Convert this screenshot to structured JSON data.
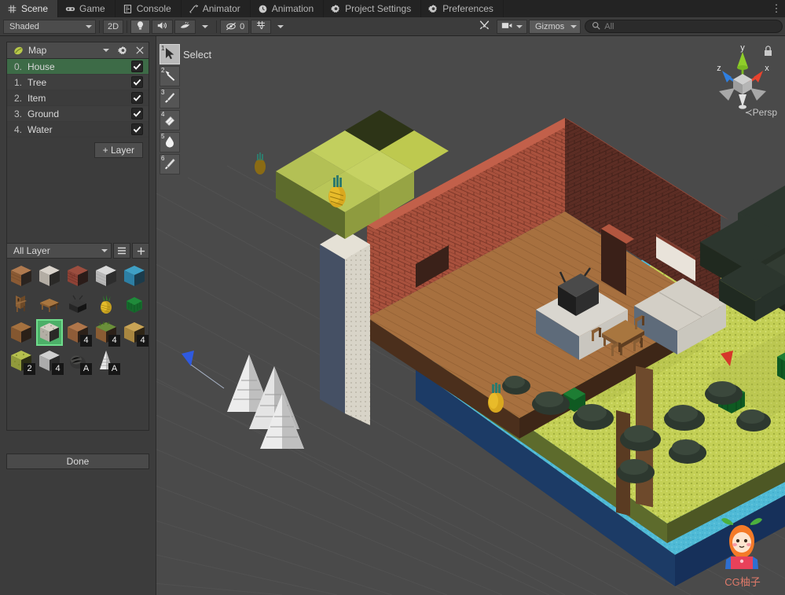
{
  "window": {
    "tabs": [
      {
        "label": "Scene",
        "icon": "grid-icon",
        "active": true
      },
      {
        "label": "Game",
        "icon": "gamepad-icon",
        "active": false
      },
      {
        "label": "Console",
        "icon": "console-icon",
        "active": false
      },
      {
        "label": "Animator",
        "icon": "animator-icon",
        "active": false
      },
      {
        "label": "Animation",
        "icon": "clock-icon",
        "active": false
      },
      {
        "label": "Project Settings",
        "icon": "gear-icon",
        "active": false
      },
      {
        "label": "Preferences",
        "icon": "gear-icon",
        "active": false
      }
    ],
    "menu_glyph": "⋮"
  },
  "toolbar": {
    "shading_mode": "Shaded",
    "two_d_label": "2D",
    "lighting_icon": "lightbulb-icon",
    "audio_icon": "speaker-icon",
    "fx_icon": "effects-icon",
    "hidden_count": "0",
    "hidden_icon": "eye-off-icon",
    "grid_icon": "grid-visibility-icon",
    "tools_icon": "tools-icon",
    "camera_icon": "camera-icon",
    "gizmos_label": "Gizmos",
    "search_placeholder": "All",
    "search_value": "",
    "search_icon": "search-icon"
  },
  "map_panel": {
    "title": "Map",
    "asset_icon": "map-asset-icon",
    "settings_icon": "gear-icon",
    "close_icon": "close-icon",
    "layers": [
      {
        "index": "0.",
        "name": "House",
        "visible": true,
        "selected": true
      },
      {
        "index": "1.",
        "name": "Tree",
        "visible": true,
        "selected": false
      },
      {
        "index": "2.",
        "name": "Item",
        "visible": true,
        "selected": false
      },
      {
        "index": "3.",
        "name": "Ground",
        "visible": true,
        "selected": false
      },
      {
        "index": "4.",
        "name": "Water",
        "visible": true,
        "selected": false
      }
    ],
    "add_layer_label": "+ Layer"
  },
  "palette": {
    "filter_label": "All Layer",
    "list_icon": "list-icon",
    "add_icon": "plus-icon",
    "tiles": [
      {
        "name": "wood-plank-block",
        "kind": "cube",
        "top": "#b07a4f",
        "left": "#8a5a34",
        "right": "#2b2420",
        "badge": ""
      },
      {
        "name": "white-stone-block",
        "kind": "cube",
        "top": "#d9d3cb",
        "left": "#b3ada4",
        "right": "#2a2927",
        "badge": ""
      },
      {
        "name": "brick-block",
        "kind": "brick",
        "top": "#9c4e3f",
        "left": "#8e4236",
        "right": "#2b1c19",
        "badge": ""
      },
      {
        "name": "concrete-block",
        "kind": "cube",
        "top": "#d8d8d8",
        "left": "#b8b8b8",
        "right": "#2d2d2d",
        "badge": ""
      },
      {
        "name": "water-block",
        "kind": "cube",
        "top": "#3f9fc4",
        "left": "#2d7fa4",
        "right": "#1b3b4b",
        "badge": ""
      },
      {
        "name": "chair-prop",
        "kind": "chair",
        "top": "#9a6c3f",
        "left": "#7d5530",
        "right": "#2a2018",
        "badge": ""
      },
      {
        "name": "table-prop",
        "kind": "table",
        "top": "#a9763f",
        "left": "#8a5d2f",
        "right": "#2a2018",
        "badge": ""
      },
      {
        "name": "tv-prop",
        "kind": "tv",
        "top": "#3a3a3a",
        "left": "#262626",
        "right": "#141414",
        "badge": ""
      },
      {
        "name": "pineapple-prop",
        "kind": "fruit",
        "top": "#e3bb2a",
        "left": "#c49f1f",
        "right": "#3a2f10",
        "badge": ""
      },
      {
        "name": "cabbage-prop",
        "kind": "cabbage",
        "top": "#1f8a3a",
        "left": "#16692c",
        "right": "#0c3317",
        "badge": ""
      },
      {
        "name": "dirt-block",
        "kind": "cube",
        "top": "#a5713f",
        "left": "#845730",
        "right": "#2b2018",
        "badge": ""
      },
      {
        "name": "gravel-block",
        "kind": "cube",
        "top": "#d6d0c6",
        "left": "#b3aea4",
        "right": "#2a2927",
        "badge": ""
      },
      {
        "name": "clay-block",
        "kind": "cube",
        "top": "#b0764a",
        "left": "#8e5c38",
        "right": "#2b2018",
        "badge": "4"
      },
      {
        "name": "grass-dirt-block",
        "kind": "grassy",
        "top": "#6b8f3a",
        "left": "#8a5c33",
        "right": "#2b2018",
        "badge": "4"
      },
      {
        "name": "sand-block",
        "kind": "cube",
        "top": "#c9a455",
        "left": "#a88640",
        "right": "#2e2516",
        "badge": "4"
      },
      {
        "name": "moss-block",
        "kind": "cube",
        "top": "#b6c04f",
        "left": "#919a3c",
        "right": "#2c2e15",
        "badge": "2"
      },
      {
        "name": "stone-block",
        "kind": "cube",
        "top": "#cfcfcf",
        "left": "#ababab",
        "right": "#2a2a2a",
        "badge": "4"
      },
      {
        "name": "bush-prop",
        "kind": "bush",
        "top": "#4a4a48",
        "left": "#343434",
        "right": "#1b1b1b",
        "badge": "A"
      },
      {
        "name": "pine-tree-prop",
        "kind": "pine",
        "top": "#e8e8e8",
        "left": "#c4c4c4",
        "right": "#8f8f8f",
        "badge": "A"
      }
    ],
    "selected_index": 11
  },
  "done_button": {
    "label": "Done"
  },
  "scene_view": {
    "tools": [
      {
        "num": "1",
        "name": "select-tool",
        "icon": "cursor-icon",
        "active": true
      },
      {
        "num": "2",
        "name": "marker-tool",
        "icon": "marker-icon",
        "active": false
      },
      {
        "num": "3",
        "name": "brush-tool",
        "icon": "brush-icon",
        "active": false
      },
      {
        "num": "4",
        "name": "eraser-tool",
        "icon": "eraser-icon",
        "active": false
      },
      {
        "num": "5",
        "name": "fill-tool",
        "icon": "droplet-icon",
        "active": false
      },
      {
        "num": "6",
        "name": "picker-tool",
        "icon": "eyedropper-icon",
        "active": false
      }
    ],
    "active_tool_label": "Select",
    "gizmo": {
      "axis_x_label": "x",
      "axis_y_label": "y",
      "axis_z_label": "z",
      "axis_x_color": "#e8432e",
      "axis_y_color": "#8fce2a",
      "axis_z_color": "#2f7fe0",
      "projection_label": "Persp",
      "projection_prefix": "≺",
      "lock_icon": "lock-icon"
    },
    "background_color": "#4a4a4a",
    "scene_content": {
      "description": "Voxel island diorama",
      "water_color": "#4fbad6",
      "water_side_color": "#1c3b66",
      "grass_color": "#c2cf4e",
      "grass_dark_color": "#5d6b2c",
      "brick_color": "#a84f3c",
      "floor_color": "#a7703f",
      "tree_dark_color": "#27312a",
      "tree_trunk_color": "#7a5134",
      "pillar_color": "#d8d4c8",
      "pineapple_color": "#d9a81f",
      "cabbage_color": "#1d7d33"
    }
  },
  "watermark": {
    "text": "CG柚子",
    "mascot": "pomelo-mascot-icon"
  }
}
